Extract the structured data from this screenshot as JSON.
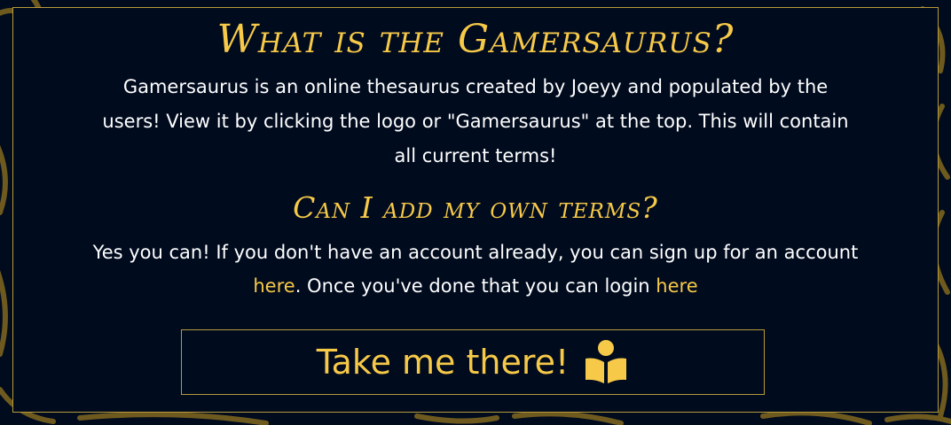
{
  "page": {
    "title": "What is the Gamersaurus?",
    "intro_text": "Gamersaurus is an online thesaurus created by Joeyy and populated by the users! View it by clicking the logo or \"Gamersaurus\" at the top. This will contain all current terms!",
    "subtitle": "Can I add my own terms?",
    "terms_text_before": "Yes you can! If you don't have an account already, you can sign up for an account ",
    "signup_link": "here",
    "terms_text_middle": ". Once you've done that you can login ",
    "login_link": "here",
    "cta_label": "Take me there!",
    "cta_icon": "book-reader-icon"
  },
  "colors": {
    "background": "#000b1e",
    "accent": "#f7c948",
    "border": "#b89a3a",
    "text": "#ffffff"
  }
}
